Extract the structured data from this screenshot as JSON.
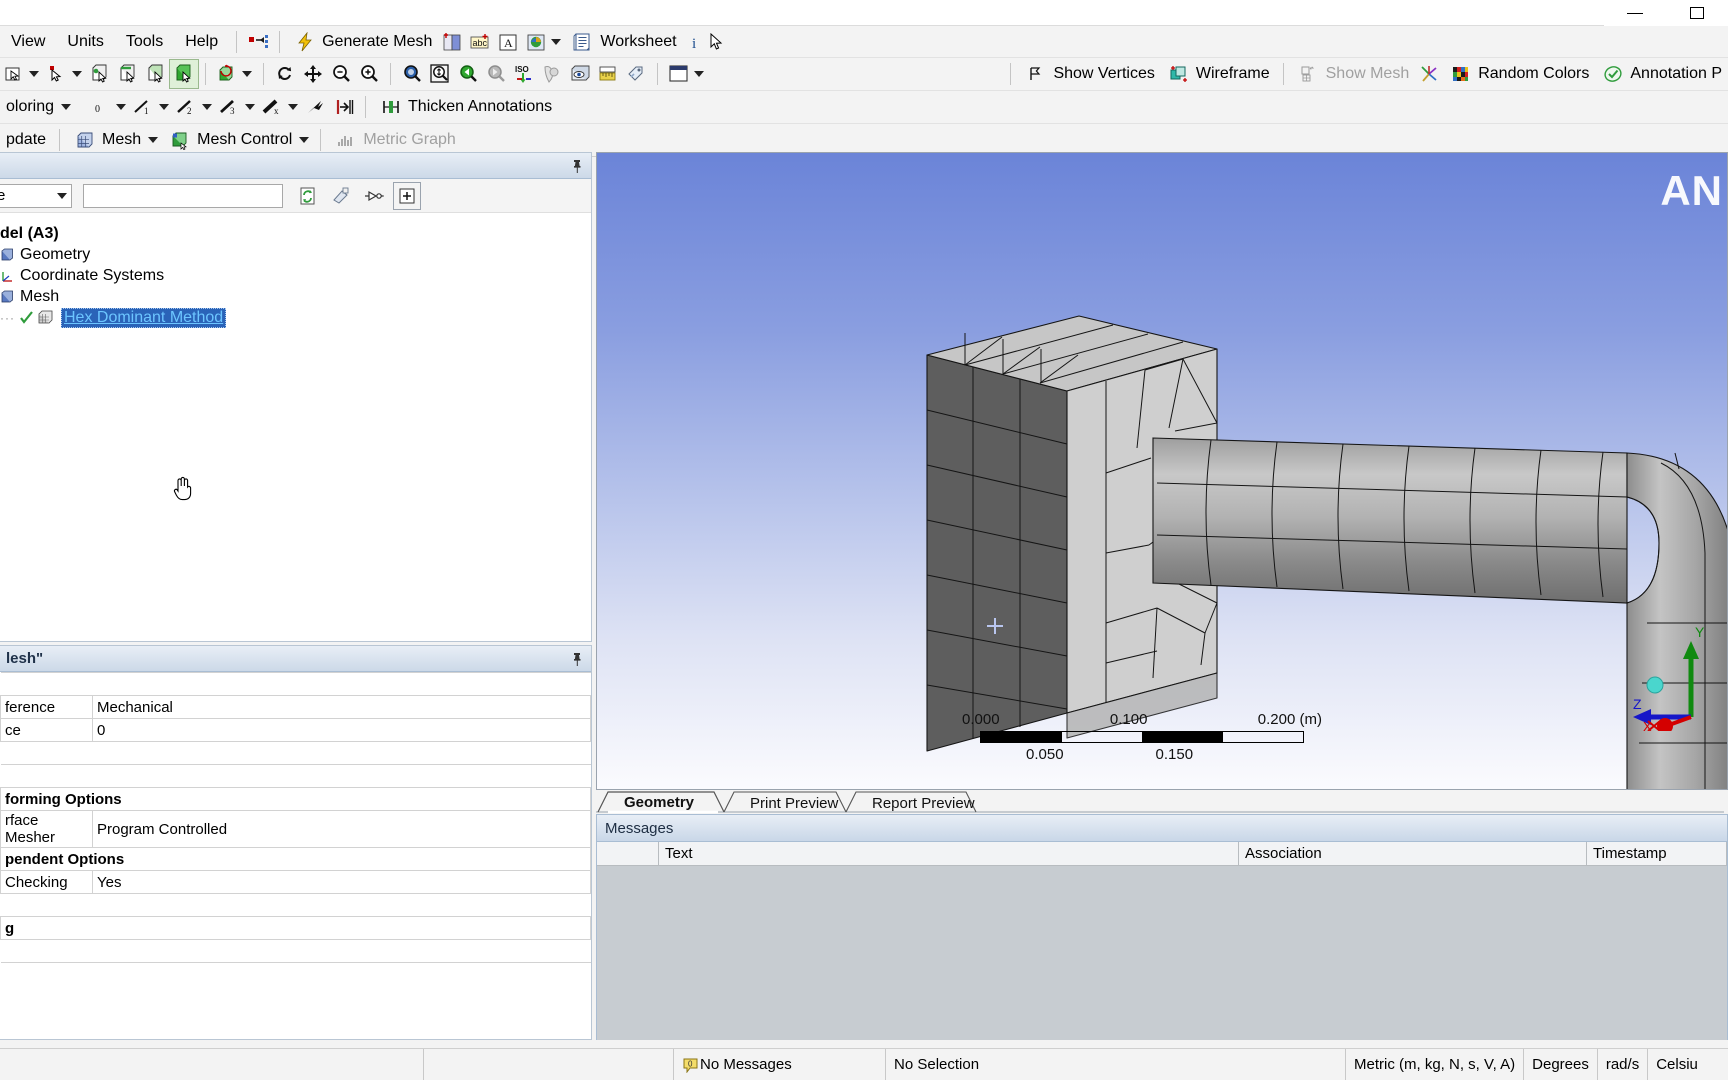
{
  "window": {
    "minimize_label": "minimize",
    "maximize_label": "maximize"
  },
  "menubar": {
    "items": [
      {
        "label": "View",
        "name": "menu-view"
      },
      {
        "label": "Units",
        "name": "menu-units"
      },
      {
        "label": "Tools",
        "name": "menu-tools"
      },
      {
        "label": "Help",
        "name": "menu-help"
      }
    ],
    "generate_mesh": "Generate Mesh",
    "worksheet": "Worksheet"
  },
  "toolbar3": {
    "coloring": "oloring",
    "zero": "0",
    "thicken_annotations": "Thicken Annotations"
  },
  "toolbar4": {
    "update": "pdate",
    "mesh": "Mesh",
    "mesh_control": "Mesh Control",
    "metric_graph": "Metric Graph"
  },
  "view_toolbar": {
    "show_vertices": "Show Vertices",
    "wireframe": "Wireframe",
    "show_mesh": "Show Mesh",
    "random_colors": "Random Colors",
    "annotation": "Annotation P"
  },
  "outline": {
    "title": "",
    "filter_select": "e",
    "filter_value": "",
    "filter_placeholder": "",
    "tree": [
      {
        "label": "del (A3)",
        "name": "tree-item-model",
        "indent": 0,
        "bold": true,
        "icon": "none",
        "selected": false
      },
      {
        "label": "Geometry",
        "name": "tree-item-geometry",
        "indent": 1,
        "bold": false,
        "icon": "geometry",
        "selected": false
      },
      {
        "label": "Coordinate Systems",
        "name": "tree-item-coordinate-systems",
        "indent": 1,
        "bold": false,
        "icon": "coordsys",
        "selected": false
      },
      {
        "label": "Mesh",
        "name": "tree-item-mesh",
        "indent": 1,
        "bold": false,
        "icon": "mesh",
        "selected": false
      },
      {
        "label": "Hex Dominant Method",
        "name": "tree-item-hex-dominant-method",
        "indent": 2,
        "bold": false,
        "icon": "method",
        "selected": true
      }
    ]
  },
  "details": {
    "title": "lesh\"",
    "rows": [
      {
        "kind": "blank",
        "key": "",
        "value": ""
      },
      {
        "kind": "row",
        "key": "ference",
        "value": "Mechanical"
      },
      {
        "kind": "row",
        "key": "ce",
        "value": "0"
      },
      {
        "kind": "blank",
        "key": "",
        "value": ""
      },
      {
        "kind": "blank",
        "key": "",
        "value": ""
      },
      {
        "kind": "group",
        "key": "forming Options",
        "value": ""
      },
      {
        "kind": "row",
        "key": "rface Mesher",
        "value": "Program Controlled"
      },
      {
        "kind": "group",
        "key": "pendent Options",
        "value": ""
      },
      {
        "kind": "row",
        "key": "Checking",
        "value": "Yes"
      },
      {
        "kind": "blank",
        "key": "",
        "value": ""
      },
      {
        "kind": "group",
        "key": "g",
        "value": ""
      },
      {
        "kind": "blank",
        "key": "",
        "value": ""
      }
    ]
  },
  "viewport": {
    "watermark": "AN",
    "scale": {
      "top_labels": [
        "0.000",
        "0.100",
        "0.200 (m)"
      ],
      "bottom_labels": [
        "0.050",
        "0.150"
      ],
      "segments": [
        true,
        false,
        true,
        false
      ]
    },
    "triad": {
      "x_label": "X",
      "y_label": "Y",
      "z_label": "Z",
      "x_color": "#d40000",
      "y_color": "#108a10",
      "z_color": "#1616c8",
      "origin_color": "#4ad6cd"
    }
  },
  "graph_tabs": [
    {
      "label": "Geometry",
      "selected": true,
      "name": "tab-geometry"
    },
    {
      "label": "Print Preview",
      "selected": false,
      "name": "tab-print-preview"
    },
    {
      "label": "Report Preview",
      "selected": false,
      "name": "tab-report-preview"
    }
  ],
  "messages": {
    "title": "Messages",
    "columns": [
      "",
      "Text",
      "Association",
      "Timestamp"
    ],
    "rows": []
  },
  "statusbar": {
    "message_count": "0",
    "no_messages": "No Messages",
    "no_selection": "No Selection",
    "unit_system": "Metric (m, kg, N, s, V, A)",
    "angle": "Degrees",
    "rotation": "rad/s",
    "temperature": "Celsiu"
  },
  "colors": {
    "selection_blue": "#2a63b8",
    "viewport_top": "#6b84d8",
    "panel_header": "#ccd9e8",
    "accent_green": "#2e9c2e"
  }
}
